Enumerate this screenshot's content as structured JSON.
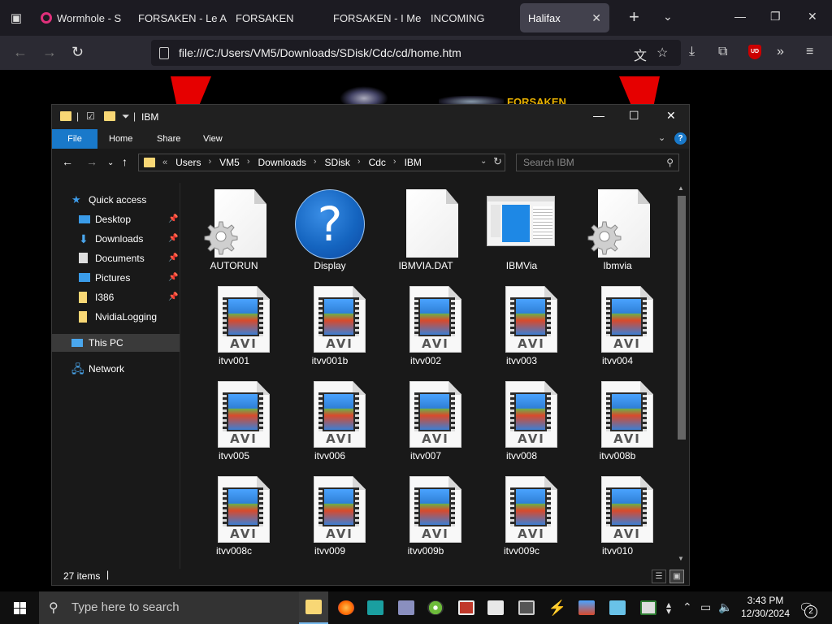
{
  "browser": {
    "tabs": [
      {
        "label": "Wormhole - S",
        "active": false,
        "favicon": true
      },
      {
        "label": "FORSAKEN - Le A",
        "active": false,
        "favicon": false
      },
      {
        "label": "FORSAKEN",
        "active": false,
        "favicon": false
      },
      {
        "label": "FORSAKEN - I Me",
        "active": false,
        "favicon": false
      },
      {
        "label": "INCOMING",
        "active": false,
        "favicon": false
      },
      {
        "label": "Halifax",
        "active": true,
        "favicon": false
      }
    ],
    "tab_close_glyph": "✕",
    "new_tab_glyph": "+",
    "url": "file:///C:/Users/VM5/Downloads/SDisk/Cdc/cd/home.htm",
    "ublock_label": "UD"
  },
  "page_behind": {
    "logo_text": "FORSAKEN"
  },
  "explorer": {
    "title": "IBM",
    "ribbon": {
      "file": "File",
      "home": "Home",
      "share": "Share",
      "view": "View"
    },
    "help_glyph": "?",
    "address": {
      "prefix": "«",
      "crumbs": [
        "Users",
        "VM5",
        "Downloads",
        "SDisk",
        "Cdc",
        "IBM"
      ]
    },
    "search_placeholder": "Search IBM",
    "nav": {
      "quick_access": "Quick access",
      "items": [
        "Desktop",
        "Downloads",
        "Documents",
        "Pictures",
        "I386",
        "NvidiaLogging"
      ],
      "this_pc": "This PC",
      "network": "Network"
    },
    "files": [
      {
        "name": "AUTORUN",
        "icon": "settings-file-icon"
      },
      {
        "name": "Display",
        "icon": "help-file-icon"
      },
      {
        "name": "IBMVIA.DAT",
        "icon": "blank-file-icon"
      },
      {
        "name": "IBMVia",
        "icon": "application-icon"
      },
      {
        "name": "Ibmvia",
        "icon": "settings-file-icon"
      },
      {
        "name": "itvv001",
        "icon": "avi-file-icon"
      },
      {
        "name": "itvv001b",
        "icon": "avi-file-icon"
      },
      {
        "name": "itvv002",
        "icon": "avi-file-icon"
      },
      {
        "name": "itvv003",
        "icon": "avi-file-icon"
      },
      {
        "name": "itvv004",
        "icon": "avi-file-icon"
      },
      {
        "name": "itvv005",
        "icon": "avi-file-icon"
      },
      {
        "name": "itvv006",
        "icon": "avi-file-icon"
      },
      {
        "name": "itvv007",
        "icon": "avi-file-icon"
      },
      {
        "name": "itvv008",
        "icon": "avi-file-icon"
      },
      {
        "name": "itvv008b",
        "icon": "avi-file-icon"
      },
      {
        "name": "itvv008c",
        "icon": "avi-file-icon"
      },
      {
        "name": "itvv009",
        "icon": "avi-file-icon"
      },
      {
        "name": "itvv009b",
        "icon": "avi-file-icon"
      },
      {
        "name": "itvv009c",
        "icon": "avi-file-icon"
      },
      {
        "name": "itvv010",
        "icon": "avi-file-icon"
      }
    ],
    "avi_label": "AVI",
    "status": "27 items"
  },
  "taskbar": {
    "search_placeholder": "Type here to search",
    "time": "3:43 PM",
    "date": "12/30/2024",
    "notification_count": "2"
  },
  "colors": {
    "accent": "#1979ca",
    "tab_favicon": "#e0307b",
    "folder": "#f8d775"
  }
}
